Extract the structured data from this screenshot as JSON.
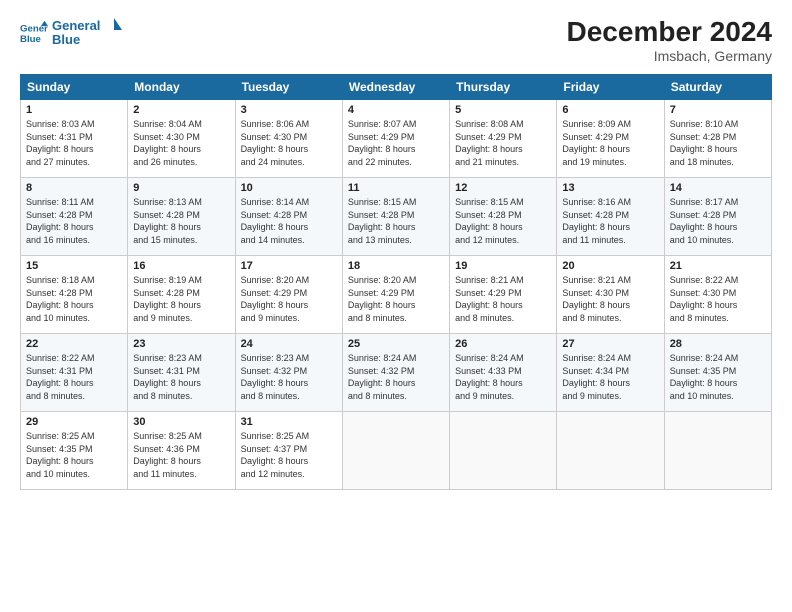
{
  "header": {
    "logo_line1": "General",
    "logo_line2": "Blue",
    "month_year": "December 2024",
    "location": "Imsbach, Germany"
  },
  "weekdays": [
    "Sunday",
    "Monday",
    "Tuesday",
    "Wednesday",
    "Thursday",
    "Friday",
    "Saturday"
  ],
  "weeks": [
    [
      {
        "day": "1",
        "info": "Sunrise: 8:03 AM\nSunset: 4:31 PM\nDaylight: 8 hours\nand 27 minutes."
      },
      {
        "day": "2",
        "info": "Sunrise: 8:04 AM\nSunset: 4:30 PM\nDaylight: 8 hours\nand 26 minutes."
      },
      {
        "day": "3",
        "info": "Sunrise: 8:06 AM\nSunset: 4:30 PM\nDaylight: 8 hours\nand 24 minutes."
      },
      {
        "day": "4",
        "info": "Sunrise: 8:07 AM\nSunset: 4:29 PM\nDaylight: 8 hours\nand 22 minutes."
      },
      {
        "day": "5",
        "info": "Sunrise: 8:08 AM\nSunset: 4:29 PM\nDaylight: 8 hours\nand 21 minutes."
      },
      {
        "day": "6",
        "info": "Sunrise: 8:09 AM\nSunset: 4:29 PM\nDaylight: 8 hours\nand 19 minutes."
      },
      {
        "day": "7",
        "info": "Sunrise: 8:10 AM\nSunset: 4:28 PM\nDaylight: 8 hours\nand 18 minutes."
      }
    ],
    [
      {
        "day": "8",
        "info": "Sunrise: 8:11 AM\nSunset: 4:28 PM\nDaylight: 8 hours\nand 16 minutes."
      },
      {
        "day": "9",
        "info": "Sunrise: 8:13 AM\nSunset: 4:28 PM\nDaylight: 8 hours\nand 15 minutes."
      },
      {
        "day": "10",
        "info": "Sunrise: 8:14 AM\nSunset: 4:28 PM\nDaylight: 8 hours\nand 14 minutes."
      },
      {
        "day": "11",
        "info": "Sunrise: 8:15 AM\nSunset: 4:28 PM\nDaylight: 8 hours\nand 13 minutes."
      },
      {
        "day": "12",
        "info": "Sunrise: 8:15 AM\nSunset: 4:28 PM\nDaylight: 8 hours\nand 12 minutes."
      },
      {
        "day": "13",
        "info": "Sunrise: 8:16 AM\nSunset: 4:28 PM\nDaylight: 8 hours\nand 11 minutes."
      },
      {
        "day": "14",
        "info": "Sunrise: 8:17 AM\nSunset: 4:28 PM\nDaylight: 8 hours\nand 10 minutes."
      }
    ],
    [
      {
        "day": "15",
        "info": "Sunrise: 8:18 AM\nSunset: 4:28 PM\nDaylight: 8 hours\nand 10 minutes."
      },
      {
        "day": "16",
        "info": "Sunrise: 8:19 AM\nSunset: 4:28 PM\nDaylight: 8 hours\nand 9 minutes."
      },
      {
        "day": "17",
        "info": "Sunrise: 8:20 AM\nSunset: 4:29 PM\nDaylight: 8 hours\nand 9 minutes."
      },
      {
        "day": "18",
        "info": "Sunrise: 8:20 AM\nSunset: 4:29 PM\nDaylight: 8 hours\nand 8 minutes."
      },
      {
        "day": "19",
        "info": "Sunrise: 8:21 AM\nSunset: 4:29 PM\nDaylight: 8 hours\nand 8 minutes."
      },
      {
        "day": "20",
        "info": "Sunrise: 8:21 AM\nSunset: 4:30 PM\nDaylight: 8 hours\nand 8 minutes."
      },
      {
        "day": "21",
        "info": "Sunrise: 8:22 AM\nSunset: 4:30 PM\nDaylight: 8 hours\nand 8 minutes."
      }
    ],
    [
      {
        "day": "22",
        "info": "Sunrise: 8:22 AM\nSunset: 4:31 PM\nDaylight: 8 hours\nand 8 minutes."
      },
      {
        "day": "23",
        "info": "Sunrise: 8:23 AM\nSunset: 4:31 PM\nDaylight: 8 hours\nand 8 minutes."
      },
      {
        "day": "24",
        "info": "Sunrise: 8:23 AM\nSunset: 4:32 PM\nDaylight: 8 hours\nand 8 minutes."
      },
      {
        "day": "25",
        "info": "Sunrise: 8:24 AM\nSunset: 4:32 PM\nDaylight: 8 hours\nand 8 minutes."
      },
      {
        "day": "26",
        "info": "Sunrise: 8:24 AM\nSunset: 4:33 PM\nDaylight: 8 hours\nand 9 minutes."
      },
      {
        "day": "27",
        "info": "Sunrise: 8:24 AM\nSunset: 4:34 PM\nDaylight: 8 hours\nand 9 minutes."
      },
      {
        "day": "28",
        "info": "Sunrise: 8:24 AM\nSunset: 4:35 PM\nDaylight: 8 hours\nand 10 minutes."
      }
    ],
    [
      {
        "day": "29",
        "info": "Sunrise: 8:25 AM\nSunset: 4:35 PM\nDaylight: 8 hours\nand 10 minutes."
      },
      {
        "day": "30",
        "info": "Sunrise: 8:25 AM\nSunset: 4:36 PM\nDaylight: 8 hours\nand 11 minutes."
      },
      {
        "day": "31",
        "info": "Sunrise: 8:25 AM\nSunset: 4:37 PM\nDaylight: 8 hours\nand 12 minutes."
      },
      {
        "day": "",
        "info": ""
      },
      {
        "day": "",
        "info": ""
      },
      {
        "day": "",
        "info": ""
      },
      {
        "day": "",
        "info": ""
      }
    ]
  ]
}
